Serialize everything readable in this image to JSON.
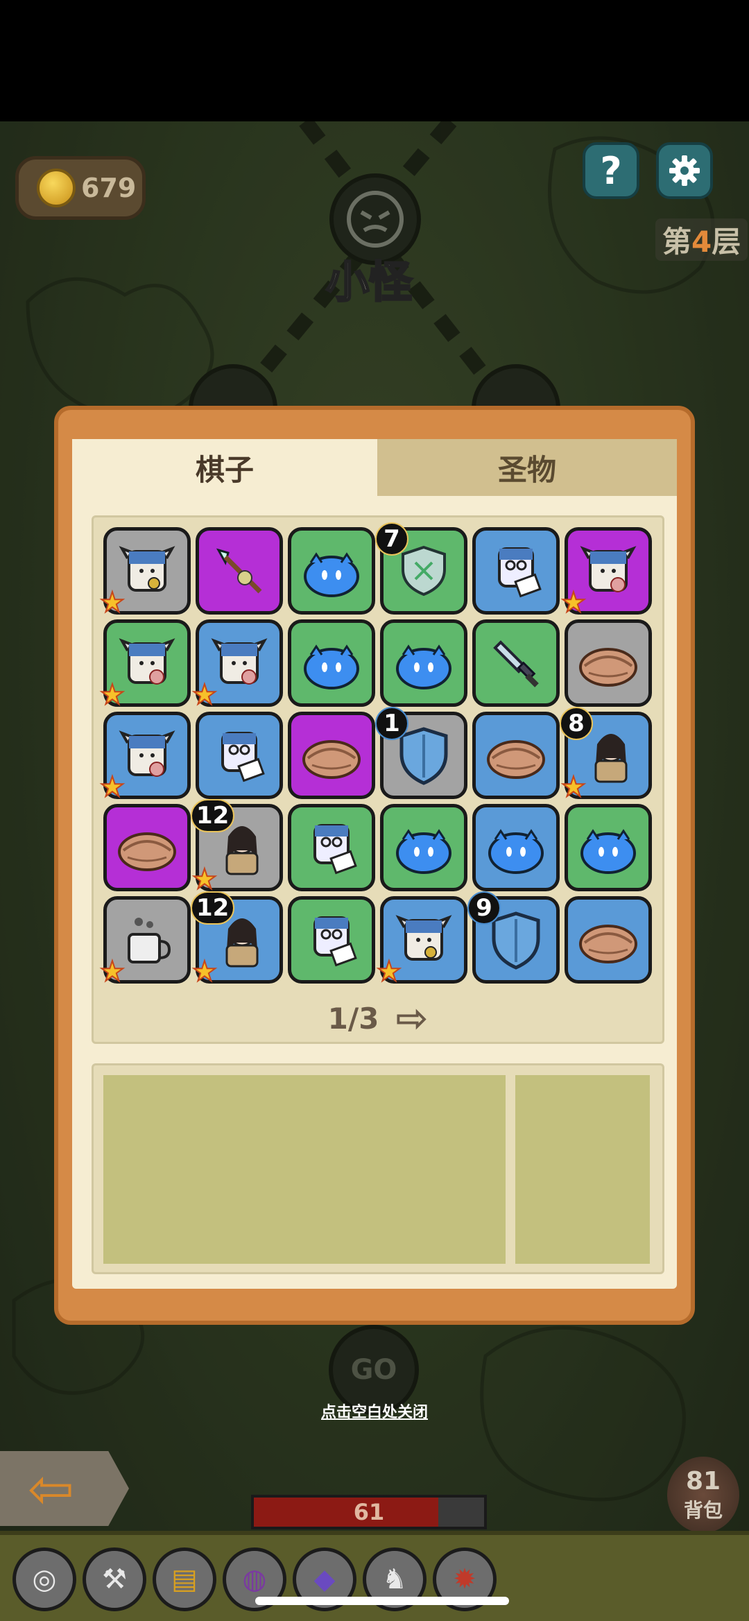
{
  "hud": {
    "coins": "679",
    "floor_prefix": "第",
    "floor_number": "4",
    "floor_suffix": "层",
    "help_icon": "question-icon",
    "settings_icon": "gear-icon"
  },
  "map": {
    "node_label": "小怪",
    "go_label": "GO",
    "close_hint": "点击空白处关闭"
  },
  "modal": {
    "tab_pieces": "棋子",
    "tab_relics": "圣物",
    "pager": "1/3",
    "cells": [
      {
        "bg": "gray",
        "icon": "viking-key-icon",
        "star": true,
        "badge": ""
      },
      {
        "bg": "purple",
        "icon": "spear-icon",
        "star": false,
        "badge": ""
      },
      {
        "bg": "green",
        "icon": "blue-slime-icon",
        "star": false,
        "badge": ""
      },
      {
        "bg": "green",
        "icon": "broken-shield-icon",
        "star": false,
        "badge": "7"
      },
      {
        "bg": "blue",
        "icon": "scholar-icon",
        "star": false,
        "badge": ""
      },
      {
        "bg": "purple",
        "icon": "viking-icon",
        "star": true,
        "badge": ""
      },
      {
        "bg": "green",
        "icon": "viking-icon",
        "star": true,
        "badge": ""
      },
      {
        "bg": "blue",
        "icon": "viking-icon",
        "star": true,
        "badge": ""
      },
      {
        "bg": "green",
        "icon": "blue-slime-icon",
        "star": false,
        "badge": ""
      },
      {
        "bg": "green",
        "icon": "blue-slime-icon",
        "star": false,
        "badge": ""
      },
      {
        "bg": "green",
        "icon": "sword-icon",
        "star": false,
        "badge": ""
      },
      {
        "bg": "gray",
        "icon": "nest-icon",
        "star": false,
        "badge": ""
      },
      {
        "bg": "blue",
        "icon": "viking-icon",
        "star": true,
        "badge": ""
      },
      {
        "bg": "blue",
        "icon": "scholar-icon",
        "star": false,
        "badge": ""
      },
      {
        "bg": "purple",
        "icon": "nest-icon",
        "star": false,
        "badge": ""
      },
      {
        "bg": "gray",
        "icon": "shield-icon",
        "star": false,
        "badge": "1",
        "badge_style": "blue"
      },
      {
        "bg": "blue",
        "icon": "nest-icon",
        "star": false,
        "badge": ""
      },
      {
        "bg": "blue",
        "icon": "warrior-girl-icon",
        "star": true,
        "badge": "8"
      },
      {
        "bg": "purple",
        "icon": "nest-icon",
        "star": false,
        "badge": ""
      },
      {
        "bg": "gray",
        "icon": "warrior-girl-icon",
        "star": true,
        "badge": "12"
      },
      {
        "bg": "green",
        "icon": "scholar-icon",
        "star": false,
        "badge": ""
      },
      {
        "bg": "green",
        "icon": "blue-slime-icon",
        "star": false,
        "badge": ""
      },
      {
        "bg": "blue",
        "icon": "blue-slime-icon",
        "star": false,
        "badge": ""
      },
      {
        "bg": "green",
        "icon": "blue-slime-icon",
        "star": false,
        "badge": ""
      },
      {
        "bg": "gray",
        "icon": "coffee-cup-icon",
        "star": true,
        "badge": ""
      },
      {
        "bg": "blue",
        "icon": "warrior-girl-icon",
        "star": true,
        "badge": "12"
      },
      {
        "bg": "green",
        "icon": "scholar-icon",
        "star": false,
        "badge": ""
      },
      {
        "bg": "blue",
        "icon": "viking-key-icon",
        "star": true,
        "badge": ""
      },
      {
        "bg": "blue",
        "icon": "shield-icon",
        "star": false,
        "badge": "9",
        "badge_style": "blue"
      },
      {
        "bg": "blue",
        "icon": "nest-icon",
        "star": false,
        "badge": ""
      }
    ]
  },
  "bottom": {
    "hp": "61",
    "hp_fraction": 0.8,
    "bag_count": "81",
    "bag_label": "背包",
    "tray": [
      "coins-icon",
      "hammer-icon",
      "book-icon",
      "ring-icon",
      "crystal-card-icon",
      "goat-icon",
      "dragon-icon"
    ]
  }
}
